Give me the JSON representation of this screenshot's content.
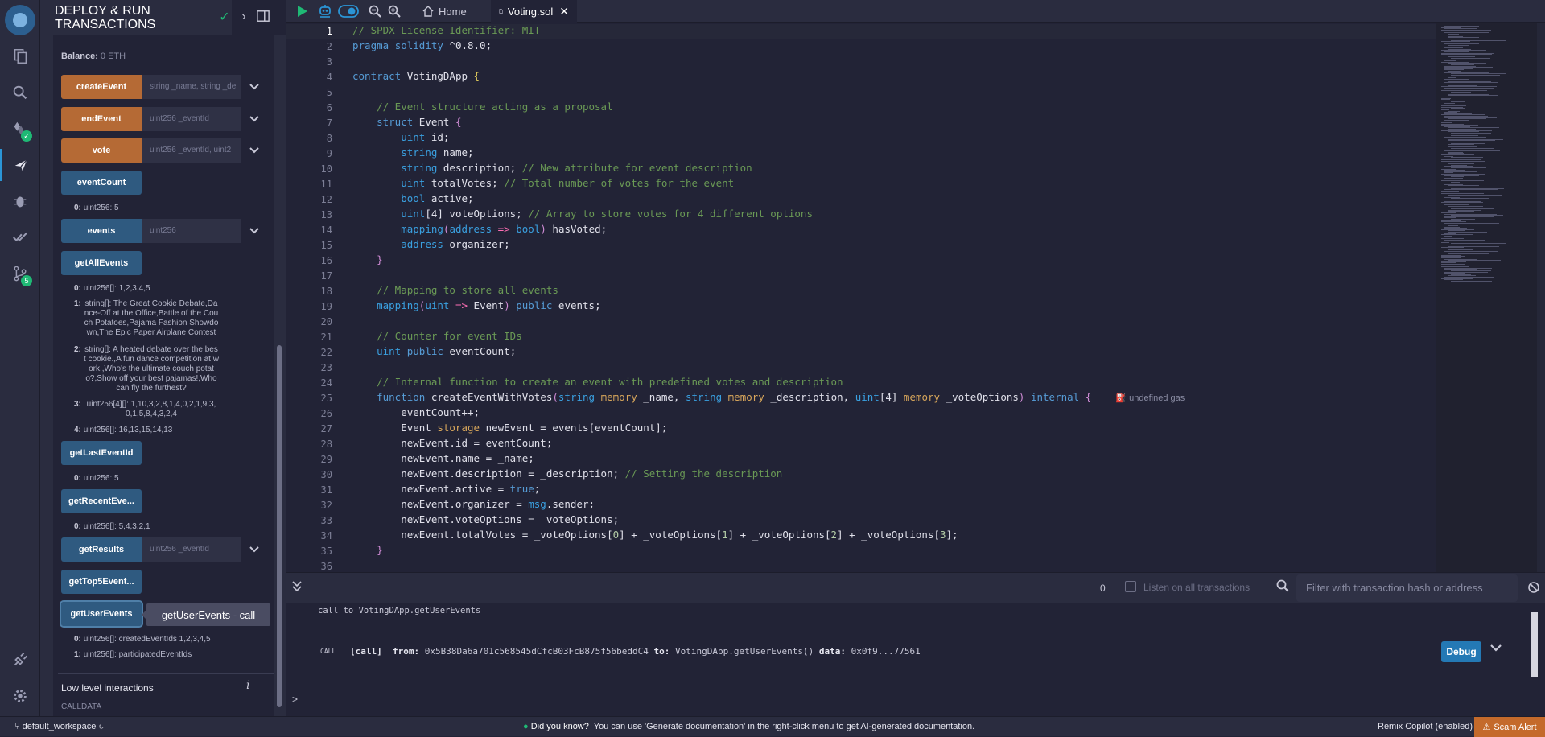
{
  "colors": {
    "accent": "#2b95d6",
    "transact_button": "#b56a35",
    "call_button": "#2f5a80",
    "status_ok": "#1fb975",
    "scam_alert": "#c46a2b"
  },
  "icon_bar": {
    "items": [
      {
        "name": "remix-logo"
      },
      {
        "name": "file-explorer-icon"
      },
      {
        "name": "search-icon"
      },
      {
        "name": "solidity-compiler-icon",
        "badge": "✓"
      },
      {
        "name": "deploy-run-icon"
      },
      {
        "name": "debugger-icon"
      },
      {
        "name": "unit-testing-icon"
      },
      {
        "name": "git-icon",
        "badge": "5"
      },
      {
        "name": "plugin-manager-icon"
      },
      {
        "name": "settings-icon"
      }
    ]
  },
  "panel": {
    "title": "DEPLOY & RUN TRANSACTIONS",
    "balance_label": "Balance:",
    "balance_value": "0 ETH",
    "functions": [
      {
        "name": "createEvent",
        "kind": "transact",
        "input": "string _name, string _de"
      },
      {
        "name": "endEvent",
        "kind": "transact",
        "input": "uint256 _eventId"
      },
      {
        "name": "vote",
        "kind": "transact",
        "input": "uint256 _eventId, uint2"
      },
      {
        "name": "eventCount",
        "kind": "call"
      },
      {
        "name": "events",
        "kind": "call",
        "input": "uint256"
      },
      {
        "name": "getAllEvents",
        "kind": "call"
      },
      {
        "name": "getLastEventId",
        "kind": "call"
      },
      {
        "name": "getRecentEve...",
        "kind": "call"
      },
      {
        "name": "getResults",
        "kind": "call",
        "input": "uint256 _eventId"
      },
      {
        "name": "getTop5Event...",
        "kind": "call"
      },
      {
        "name": "getUserEvents",
        "kind": "call"
      }
    ],
    "outputs": {
      "eventCount": [
        {
          "key": "0:",
          "value": "uint256: 5"
        }
      ],
      "getAllEvents": [
        {
          "key": "0:",
          "value": "uint256[]: 1,2,3,4,5"
        },
        {
          "key": "1:",
          "value": "string[]: The Great Cookie Debate,Dance-Off at the Office,Battle of the Couch Potatoes,Pajama Fashion Showdown,The Epic Paper Airplane Contest"
        },
        {
          "key": "2:",
          "value": "string[]: A heated debate over the best cookie.,A fun dance competition at work.,Who's the ultimate couch potato?,Show off your best pajamas!,Who can fly the furthest?"
        },
        {
          "key": "3:",
          "value": "uint256[4][]: 1,10,3,2,8,1,4,0,2,1,9,3,0,1,5,8,4,3,2,4"
        },
        {
          "key": "4:",
          "value": "uint256[]: 16,13,15,14,13"
        }
      ],
      "getLastEventId": [
        {
          "key": "0:",
          "value": "uint256: 5"
        }
      ],
      "getRecentEvents": [
        {
          "key": "0:",
          "value": "uint256[]: 5,4,3,2,1"
        }
      ],
      "getUserEvents": [
        {
          "key": "0:",
          "value": "uint256[]: createdEventIds 1,2,3,4,5"
        },
        {
          "key": "1:",
          "value": "uint256[]: participatedEventIds"
        }
      ]
    },
    "tooltip": "getUserEvents - call",
    "low_level_title": "Low level interactions",
    "calldata_label": "CALLDATA"
  },
  "topbar": {
    "tabs": [
      {
        "label": "Home",
        "icon": "home-icon"
      },
      {
        "label": "Voting.sol",
        "icon": "file-icon",
        "active": true
      }
    ]
  },
  "editor": {
    "line_numbers": [
      "1",
      "2",
      "3",
      "4",
      "5",
      "6",
      "7",
      "8",
      "9",
      "10",
      "11",
      "12",
      "13",
      "14",
      "15",
      "16",
      "17",
      "18",
      "19",
      "20",
      "21",
      "22",
      "23",
      "24",
      "25",
      "26",
      "27",
      "28",
      "29",
      "30",
      "31",
      "32",
      "33",
      "34",
      "35",
      "36"
    ],
    "current_line": "1",
    "gas_hint": "undefined gas"
  },
  "terminal": {
    "tx_count": "0",
    "listen_label": "Listen on all transactions",
    "filter_placeholder": "Filter with transaction hash or address",
    "log_line": "call to VotingDApp.getUserEvents",
    "call_tag": "CALL",
    "call_label": "[call]",
    "from_label": "from:",
    "from_value": "0x5B38Da6a701c568545dCfcB03FcB875f56beddC4",
    "to_label": "to:",
    "to_value": "VotingDApp.getUserEvents()",
    "data_label": "data:",
    "data_value": "0x0f9...77561",
    "debug_label": "Debug",
    "prompt": ">"
  },
  "statusbar": {
    "workspace": "default_workspace",
    "tip_title": "Did you know?",
    "tip_text": "You can use 'Generate documentation' in the right-click menu to get AI-generated documentation.",
    "copilot": "Remix Copilot (enabled)",
    "scam_alert": "Scam Alert"
  }
}
